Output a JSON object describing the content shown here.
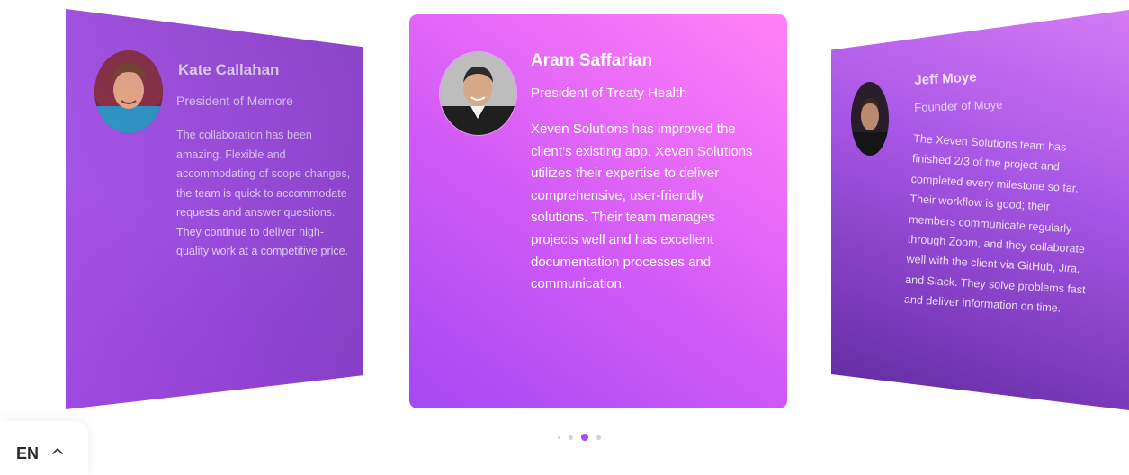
{
  "testimonials": [
    {
      "name": "Kate Callahan",
      "role": "President of Memore",
      "quote": "The collaboration has been amazing. Flexible and accommodating of scope changes, the team is quick to accommodate requests and answer questions. They continue to deliver high-quality work at a competitive price."
    },
    {
      "name": "Aram Saffarian",
      "role": "President of Treaty Health",
      "quote": "Xeven Solutions has improved the client’s existing app. Xeven Solutions utilizes their expertise to deliver comprehensive, user-friendly solutions. Their team manages projects well and has excellent documentation processes and communication."
    },
    {
      "name": "Jeff Moye",
      "role": "Founder of Moye",
      "quote": "The Xeven Solutions team has finished 2/3 of the project and completed every milestone so far. Their workflow is good; their members communicate regularly through Zoom, and they collaborate well with the client via GitHub, Jira, and Slack. They solve problems fast and deliver information on time."
    }
  ],
  "pagination": {
    "count": 4,
    "active_index": 2
  },
  "language": {
    "code": "EN",
    "icon": "chevron-up-icon"
  },
  "colors": {
    "accent": "#a44bf3",
    "card_gradient_start": "#ff82f7",
    "card_gradient_end": "#a548f3",
    "dot_inactive": "#d4cfd9"
  }
}
